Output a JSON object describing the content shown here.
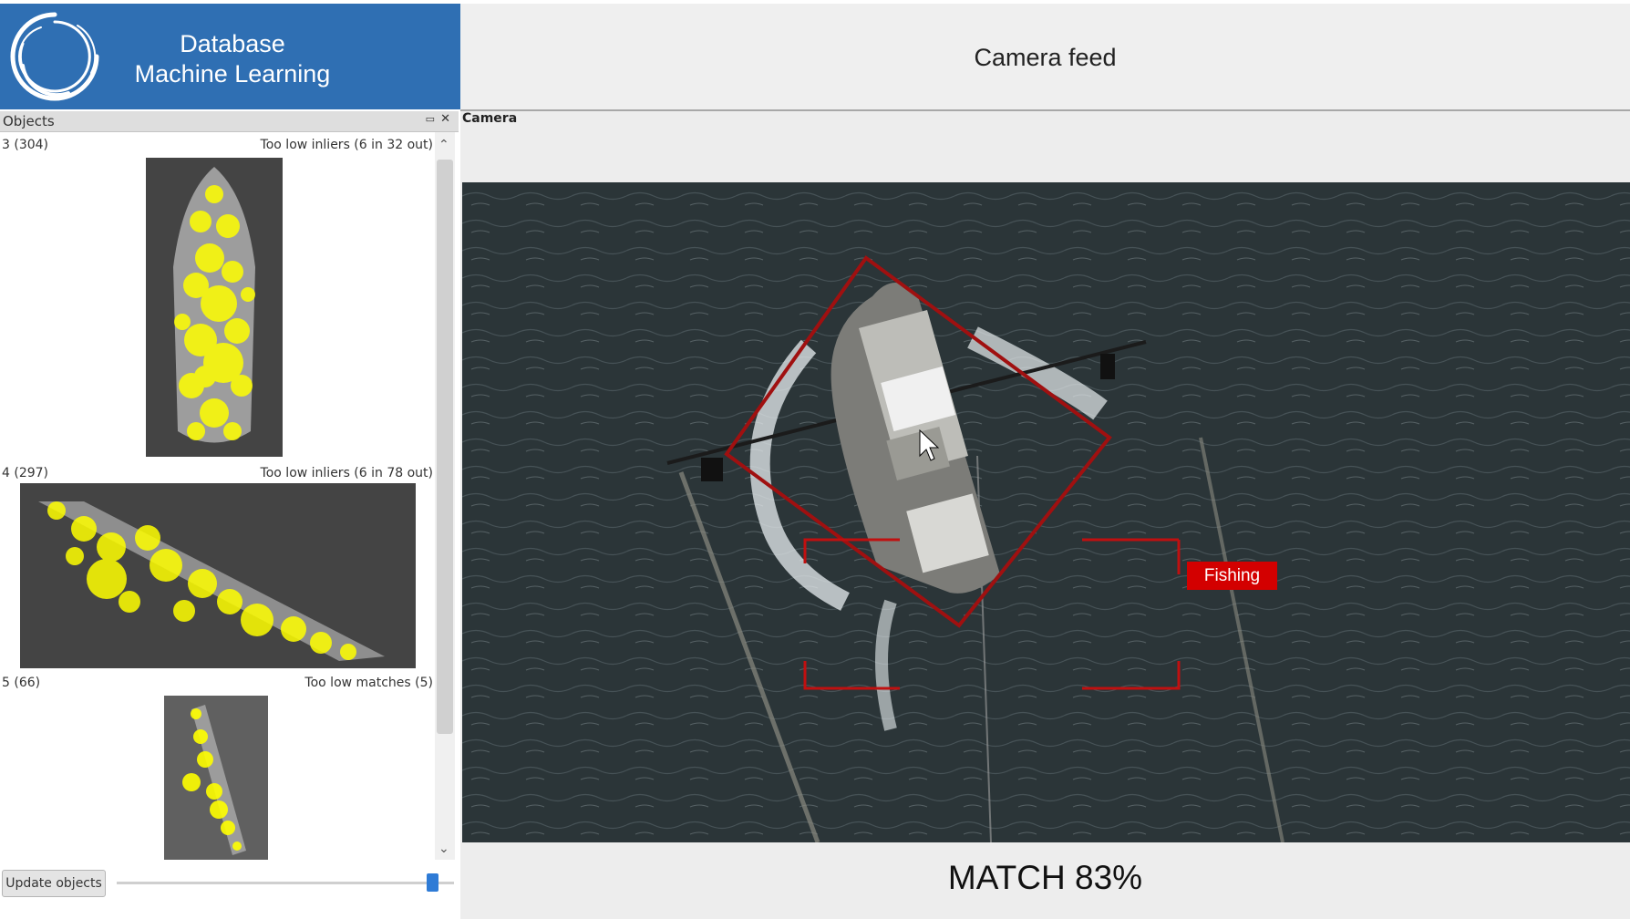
{
  "brand": {
    "line1": "Database",
    "line2": "Machine Learning",
    "bg_color": "#2f6fb3",
    "logo_icon": "circular-swirl-logo"
  },
  "header": {
    "title": "Camera feed"
  },
  "objects_dock": {
    "title": "Objects",
    "float_icon": "float-icon",
    "close_icon": "close-icon",
    "items": [
      {
        "id_label": "3 (304)",
        "status": "Too low inliers (6 in 32 out)"
      },
      {
        "id_label": "4 (297)",
        "status": "Too low inliers (6 in 78 out)"
      },
      {
        "id_label": "5 (66)",
        "status": "Too low matches (5)"
      }
    ],
    "update_button": "Update objects",
    "slider_level": 0.95
  },
  "camera_dock": {
    "title": "Camera",
    "detection_label": "Fishing",
    "detection_color": "#d30000",
    "match_text": "MATCH 83%"
  }
}
